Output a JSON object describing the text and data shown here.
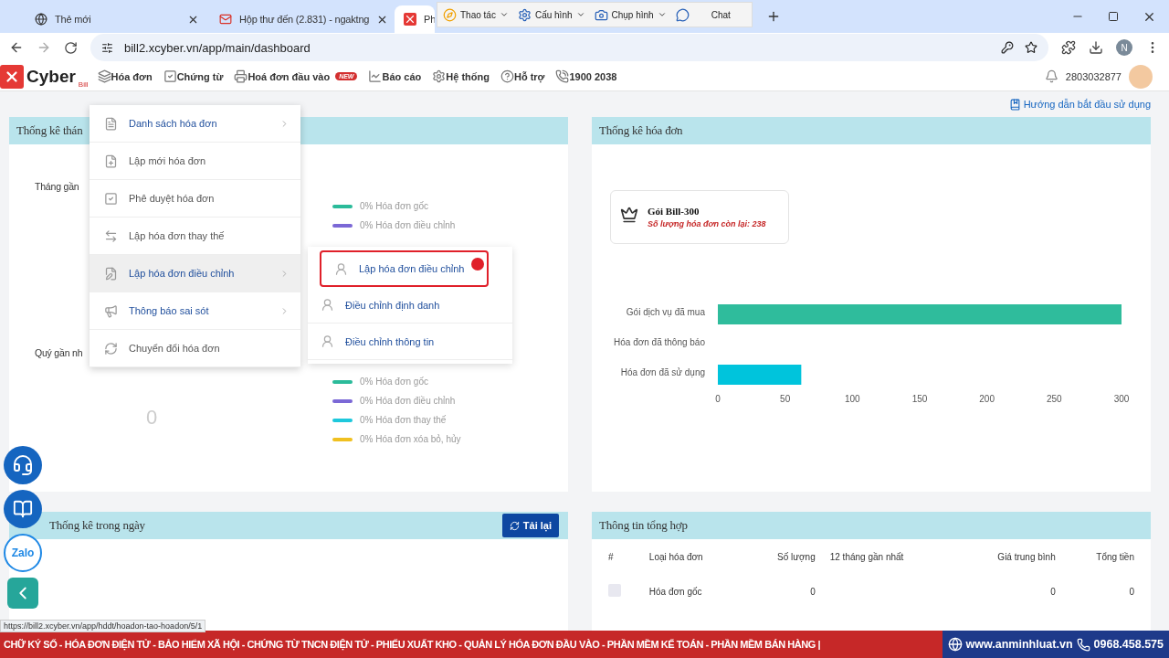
{
  "browser": {
    "tabs": [
      {
        "title": "Thẻ mới",
        "selected": false
      },
      {
        "title": "Hộp thư đến (2.831) - ngaktng",
        "selected": false
      },
      {
        "title": "Ph",
        "selected": true
      }
    ],
    "url": "bill2.xcyber.vn/app/main/dashboard",
    "profile": "N"
  },
  "recorder_toolbar": {
    "items": [
      "Thao tác",
      "Cấu hình",
      "Chụp hình",
      "Chat"
    ]
  },
  "app": {
    "logo": {
      "name": "Cyber",
      "sub": "Bill"
    },
    "nav": [
      {
        "label": "Hóa đơn"
      },
      {
        "label": "Chứng từ"
      },
      {
        "label": "Hoá đơn đầu vào",
        "badge": "NEW"
      },
      {
        "label": "Báo cáo"
      },
      {
        "label": "Hệ thống"
      },
      {
        "label": "Hỗ trợ"
      },
      {
        "label": "1900 2038"
      }
    ],
    "user": "2803032877"
  },
  "guide_link": "Hướng dẫn bắt đầu sử dụng",
  "monthly_panel": {
    "title": "Thống kê thán",
    "month_label": "Tháng gần",
    "month_legend": [
      {
        "label": "0% Hóa đơn gốc",
        "color": "#2bbb9a"
      },
      {
        "label": "0% Hóa đơn điều chỉnh",
        "color": "#7b68d6"
      }
    ],
    "quarter_label": "Quý gần nh",
    "quarter_total": "0",
    "quarter_legend": [
      {
        "label": "0% Hóa đơn gốc",
        "color": "#2bbb9a"
      },
      {
        "label": "0% Hóa đơn điều chỉnh",
        "color": "#7b68d6"
      },
      {
        "label": "0% Hóa đơn thay thế",
        "color": "#1ec8dc"
      },
      {
        "label": "0% Hóa đơn xóa bỏ, hủy",
        "color": "#f0c020"
      }
    ]
  },
  "invoice_panel": {
    "title": "Thống kê hóa đơn",
    "plan": {
      "name": "Gói Bill-300",
      "remaining": "Số lượng hóa đơn còn lại: 238"
    },
    "chart_data": {
      "type": "bar",
      "orientation": "horizontal",
      "categories": [
        "Gói dịch vụ đã mua",
        "Hóa đơn đã thông báo",
        "Hóa đơn đã sử dụng"
      ],
      "values": [
        300,
        0,
        62
      ],
      "colors": [
        "#2fbc9c",
        "#2fbc9c",
        "#00c4dc"
      ],
      "xlim": [
        0,
        300
      ],
      "xticks": [
        0,
        50,
        100,
        150,
        200,
        250,
        300
      ]
    }
  },
  "daily_panel": {
    "title": "Thống kê trong ngày",
    "button": "Tải lại"
  },
  "summary_panel": {
    "title": "Thông tin tổng hợp",
    "columns": [
      "#",
      "Loại hóa đơn",
      "Số lượng",
      "12 tháng gần nhất",
      "Giá trung bình",
      "Tổng tiền"
    ],
    "rows": [
      {
        "checked": false,
        "type": "Hóa đơn gốc",
        "count": "0",
        "average": "0",
        "total": "0"
      }
    ]
  },
  "menu": {
    "items": [
      {
        "label": "Danh sách hóa đơn",
        "has_submenu": true,
        "selected": false
      },
      {
        "label": "Lập mới hóa đơn",
        "has_submenu": false,
        "selected": false
      },
      {
        "label": "Phê duyệt hóa đơn",
        "has_submenu": false,
        "selected": false
      },
      {
        "label": "Lập hóa đơn thay thế",
        "has_submenu": false,
        "selected": false
      },
      {
        "label": "Lập hóa đơn điều chỉnh",
        "has_submenu": true,
        "selected": true
      },
      {
        "label": "Thông báo sai sót",
        "has_submenu": true,
        "selected": false
      },
      {
        "label": "Chuyển đổi hóa đơn",
        "has_submenu": false,
        "selected": false
      }
    ]
  },
  "submenu": {
    "items": [
      {
        "label": "Lập hóa đơn điều chỉnh",
        "selected": true
      },
      {
        "label": "Điều chỉnh định danh",
        "selected": false
      },
      {
        "label": "Điều chỉnh thông tin",
        "selected": false
      }
    ]
  },
  "side_buttons": {
    "zalo_label": "Zalo"
  },
  "status_url": "https://bill2.xcyber.vn/app/hddt/hoadon-tao-hoadon/5/1",
  "banner": {
    "text": "CHỮ KÝ SỐ - HÓA ĐƠN ĐIỆN TỬ - BẢO HIỂM XÃ HỘI - CHỨNG TỪ TNCN ĐIỆN TỬ - PHIẾU XUẤT KHO - QUẢN LÝ HÓA ĐƠN ĐẦU VÀO - PHẦN MỀM KẾ TOÁN - PHẦN MỀM BÁN HÀNG |",
    "website": "www.anminhluat.vn",
    "phone": "0968.458.575"
  }
}
